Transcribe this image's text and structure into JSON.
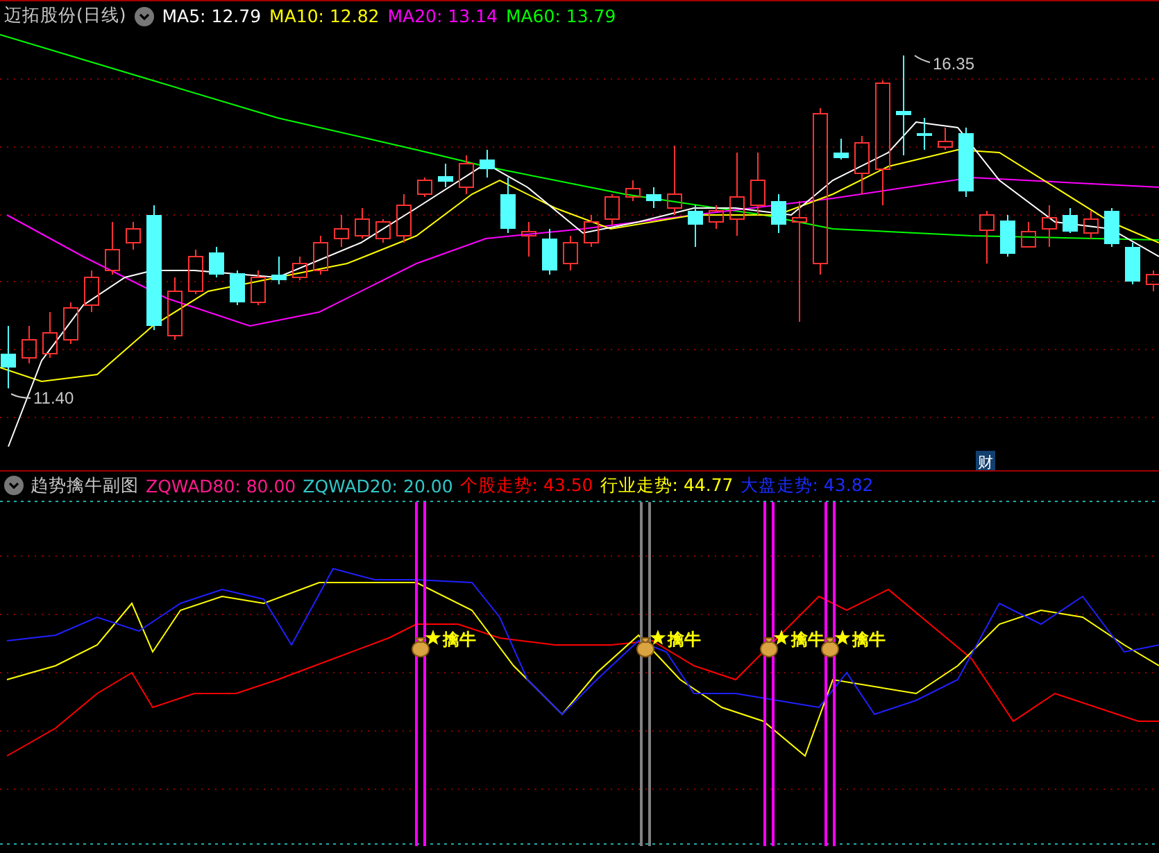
{
  "title": "迈拓股份(日线)",
  "ma_legend": [
    {
      "text": "MA5: 12.79",
      "color": "#ffffff"
    },
    {
      "text": "MA10: 12.82",
      "color": "#ffff00"
    },
    {
      "text": "MA20: 13.14",
      "color": "#ff00ff"
    },
    {
      "text": "MA60: 13.79",
      "color": "#00ff00"
    }
  ],
  "high_label": "16.35",
  "low_label": "11.40",
  "finance_badge": "财",
  "indicator": {
    "title": "趋势擒牛副图",
    "legend": [
      {
        "text": "ZQWAD80: 80.00",
        "color": "#ff1a8c"
      },
      {
        "text": "ZQWAD20: 20.00",
        "color": "#30c8c8"
      },
      {
        "text": "个股走势: 43.50",
        "color": "#ff0000"
      },
      {
        "text": "行业走势: 44.77",
        "color": "#ffff00"
      },
      {
        "text": "大盘走势: 43.82",
        "color": "#1a2cff"
      }
    ]
  },
  "signals": [
    {
      "label": "擒牛",
      "color": "#ff00ff"
    },
    {
      "label": "擒牛",
      "color": "#808080"
    },
    {
      "label": "擒牛",
      "color": "#ff00ff"
    },
    {
      "label": "擒牛",
      "color": "#ff00ff"
    }
  ]
}
